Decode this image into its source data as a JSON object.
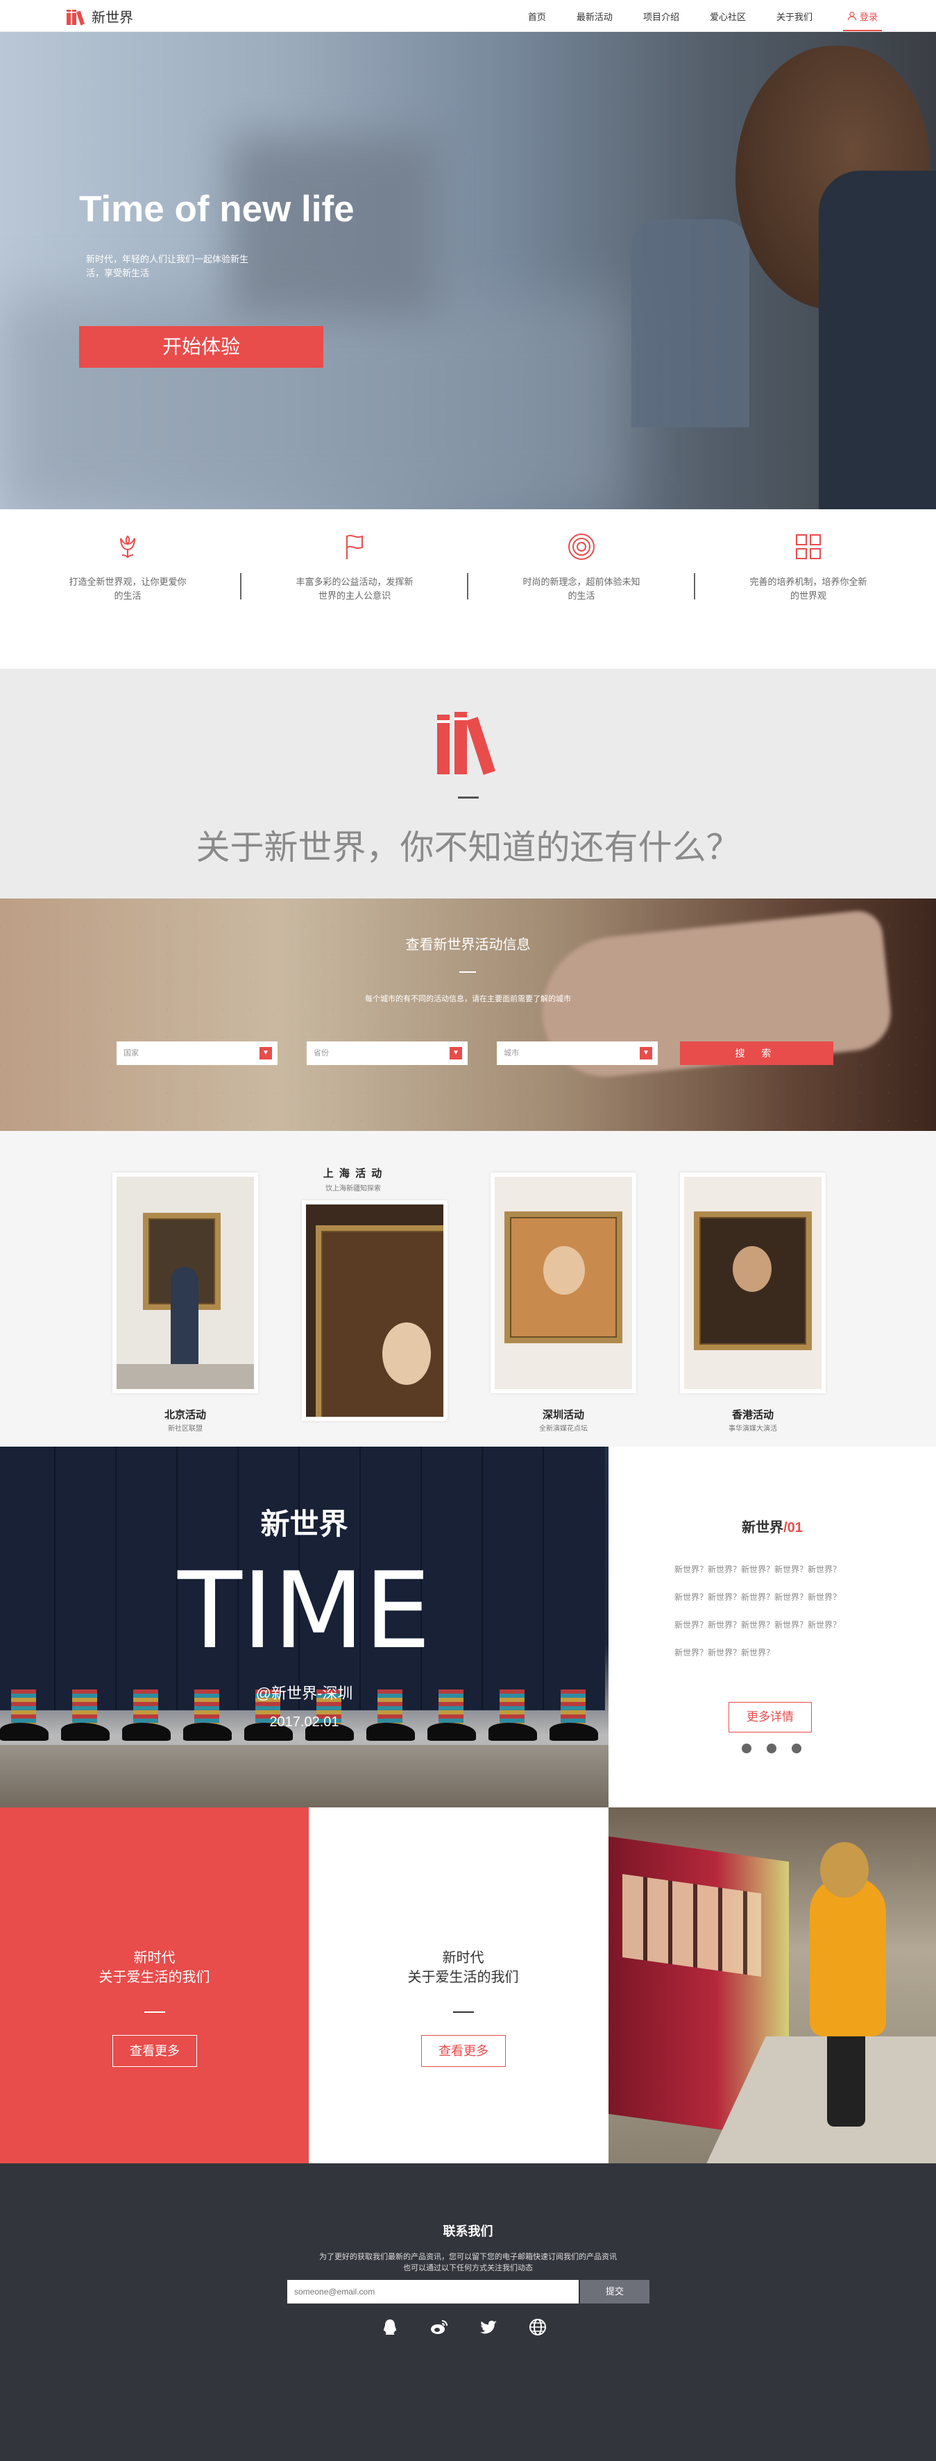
{
  "brand": {
    "name": "新世界",
    "accent": "#e84c4b",
    "icon": "books-logo-icon"
  },
  "nav": {
    "items": [
      "首页",
      "最新活动",
      "项目介绍",
      "爱心社区",
      "关于我们"
    ],
    "login": "登录"
  },
  "hero": {
    "title": "Time of new life",
    "subtitle": "新时代，年轻的人们让我们一起体验新生活，享受新生活",
    "button": "开始体验"
  },
  "features": [
    {
      "icon": "tulip-icon",
      "text": "打造全新世界观，让你更爱你的生活"
    },
    {
      "icon": "flag-icon",
      "text": "丰富多彩的公益活动，发挥新世界的主人公意识"
    },
    {
      "icon": "target-icon",
      "text": "时尚的新理念，超前体验未知的生活"
    },
    {
      "icon": "grid-icon",
      "text": "完善的培养机制，培养你全新的世界观"
    }
  ],
  "about": {
    "title": "关于新世界，你不知道的还有什么？"
  },
  "search": {
    "title": "查看新世界活动信息",
    "desc": "每个城市的有不同的活动信息，请在主要面前需要了解的城市",
    "selects": [
      {
        "placeholder": "国家"
      },
      {
        "placeholder": "省份"
      },
      {
        "placeholder": "城市"
      }
    ],
    "button": "搜 索"
  },
  "gallery": {
    "cards": [
      {
        "title": "北京活动",
        "sub": "新社区联盟"
      },
      {
        "title": "上 海 活 动",
        "sub": "饮上海新疆知探索"
      },
      {
        "title": "深圳活动",
        "sub": "全新演媒花点坛"
      },
      {
        "title": "香港活动",
        "sub": "事华演媒大演活"
      }
    ]
  },
  "time": {
    "brand": "新世界",
    "big": "TIME",
    "handle": "@新世界-深圳",
    "date": "2017.02.01"
  },
  "news": {
    "title": "新世界",
    "num": "/01",
    "lines": [
      "新世界？新世界？新世界？新世界？新世界？",
      "新世界？新世界？新世界？新世界？新世界？",
      "新世界？新世界？新世界？新世界？新世界？",
      "新世界？新世界？新世界？"
    ],
    "button": "更多详情"
  },
  "promos": [
    {
      "line1": "新时代",
      "line2": "关于爱生活的我们",
      "button": "查看更多"
    },
    {
      "line1": "新时代",
      "line2": "关于爱生活的我们",
      "button": "查看更多"
    }
  ],
  "footer": {
    "title": "联系我们",
    "desc1": "为了更好的获取我们最新的产品资讯，您可以留下您的电子邮箱快速订阅我们的产品资讯",
    "desc2": "也可以通过以下任何方式关注我们动态",
    "email_placeholder": "someone@email.com",
    "submit": "提交",
    "social": [
      "qq-icon",
      "weibo-icon",
      "twitter-icon",
      "globe-icon"
    ]
  }
}
